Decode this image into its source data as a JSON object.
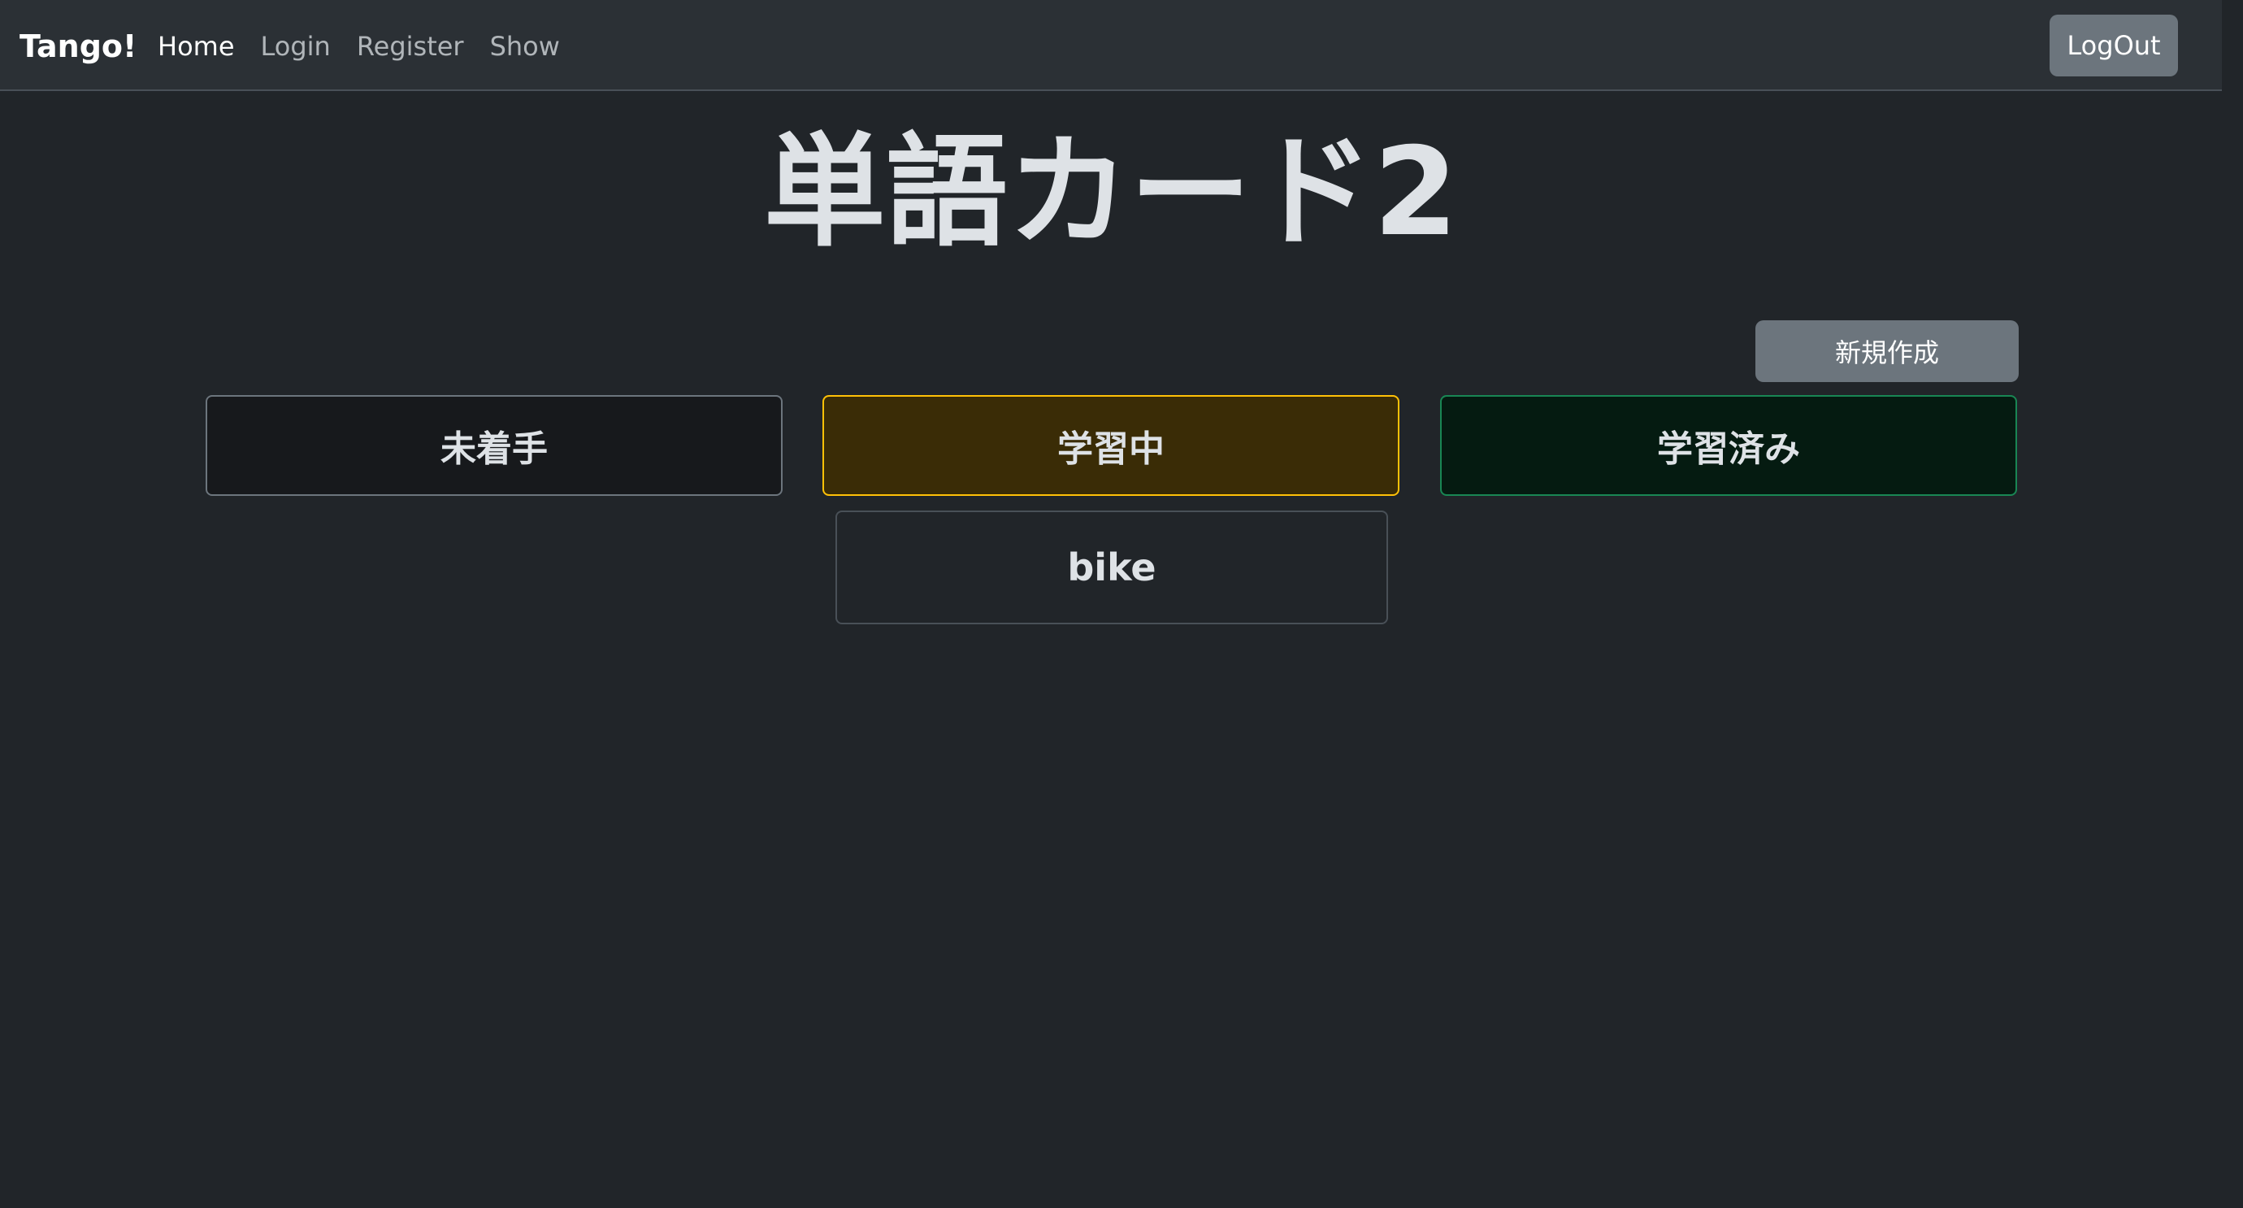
{
  "navbar": {
    "brand": "Tango!",
    "links": [
      {
        "label": "Home",
        "active": true
      },
      {
        "label": "Login",
        "active": false
      },
      {
        "label": "Register",
        "active": false
      },
      {
        "label": "Show",
        "active": false
      }
    ],
    "logout_label": "LogOut"
  },
  "main": {
    "title": "単語カード2",
    "new_button_label": "新規作成",
    "columns": [
      {
        "label": "未着手",
        "cards": []
      },
      {
        "label": "学習中",
        "cards": [
          {
            "word": "bike"
          }
        ]
      },
      {
        "label": "学習済み",
        "cards": []
      }
    ]
  },
  "colors": {
    "background": "#212529",
    "navbar": "#2b3035",
    "secondary": "#6c757d",
    "warning": "#ffc107",
    "success": "#198754"
  }
}
